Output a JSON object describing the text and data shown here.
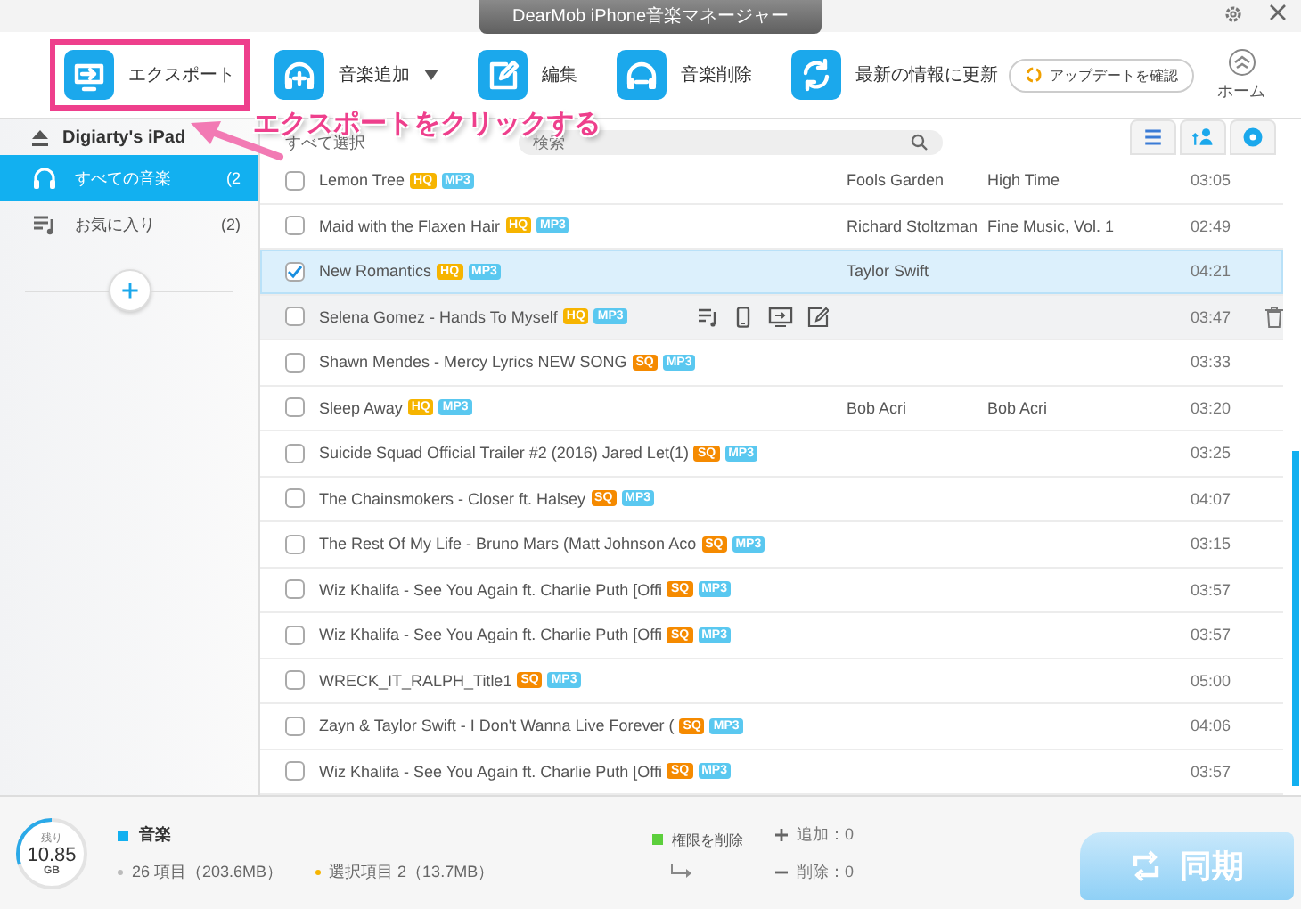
{
  "window": {
    "title": "DearMob iPhone音楽マネージャー"
  },
  "toolbar": [
    {
      "kind": "export",
      "label": "エクスポート",
      "highlighted": true,
      "dropdown": false
    },
    {
      "kind": "add",
      "label": "音楽追加",
      "highlighted": false,
      "dropdown": true
    },
    {
      "kind": "edit",
      "label": "編集",
      "highlighted": false,
      "dropdown": false
    },
    {
      "kind": "delete",
      "label": "音楽削除",
      "highlighted": false,
      "dropdown": false
    },
    {
      "kind": "refresh",
      "label": "最新の情報に更新",
      "highlighted": false,
      "dropdown": false
    }
  ],
  "update_button": "アップデートを確認",
  "home_button": "ホーム",
  "annotation": "エクスポートをクリックする",
  "sidebar": {
    "device": "Digiarty's iPad",
    "items": [
      {
        "kind": "music",
        "label": "すべての音楽",
        "count": "(2",
        "selected": true
      },
      {
        "kind": "playlist",
        "label": "お気に入り",
        "count": "(2)",
        "selected": false
      }
    ]
  },
  "list": {
    "select_all": "すべて選択",
    "search": {
      "placeholder": "検索"
    },
    "view_tabs": [
      {
        "kind": "list"
      },
      {
        "kind": "person"
      },
      {
        "kind": "disc"
      }
    ],
    "rows": [
      {
        "title": "Lemon Tree",
        "quality": {
          "label": "HQ",
          "color": "#f6b400"
        },
        "format": "MP3",
        "artist": "Fools Garden",
        "album": "High Time",
        "time": "03:05",
        "checked": false,
        "selected": false,
        "hovered": false
      },
      {
        "title": "Maid with the Flaxen Hair",
        "quality": {
          "label": "HQ",
          "color": "#f6b400"
        },
        "format": "MP3",
        "artist": "Richard Stoltzman",
        "album": "Fine Music, Vol. 1",
        "time": "02:49",
        "checked": false,
        "selected": false,
        "hovered": false
      },
      {
        "title": "New Romantics",
        "quality": {
          "label": "HQ",
          "color": "#f6b400"
        },
        "format": "MP3",
        "artist": "Taylor Swift",
        "time": "04:21",
        "checked": true,
        "selected": true,
        "hovered": false
      },
      {
        "title": "Selena Gomez - Hands To Myself",
        "quality": {
          "label": "HQ",
          "color": "#f6b400"
        },
        "format": "MP3",
        "time": "03:47",
        "checked": false,
        "selected": false,
        "hovered": true
      },
      {
        "title": "Shawn Mendes - Mercy Lyrics NEW SONG",
        "quality": {
          "label": "SQ",
          "color": "#f58a00"
        },
        "format": "MP3",
        "time": "03:33",
        "checked": false,
        "selected": false,
        "hovered": false
      },
      {
        "title": "Sleep Away",
        "quality": {
          "label": "HQ",
          "color": "#f6b400"
        },
        "format": "MP3",
        "artist": "Bob Acri",
        "album": "Bob Acri",
        "time": "03:20",
        "checked": false,
        "selected": false,
        "hovered": false
      },
      {
        "title": "Suicide Squad Official Trailer #2 (2016) Jared Let(1)",
        "quality": {
          "label": "SQ",
          "color": "#f58a00"
        },
        "format": "MP3",
        "time": "03:25",
        "checked": false,
        "selected": false,
        "hovered": false
      },
      {
        "title": "The Chainsmokers - Closer ft. Halsey",
        "quality": {
          "label": "SQ",
          "color": "#f58a00"
        },
        "format": "MP3",
        "time": "04:07",
        "checked": false,
        "selected": false,
        "hovered": false
      },
      {
        "title": "The Rest Of My Life - Bruno Mars (Matt Johnson Aco",
        "quality": {
          "label": "SQ",
          "color": "#f58a00"
        },
        "format": "MP3",
        "time": "03:15",
        "checked": false,
        "selected": false,
        "hovered": false
      },
      {
        "title": "Wiz Khalifa - See You Again ft. Charlie Puth [Offi",
        "quality": {
          "label": "SQ",
          "color": "#f58a00"
        },
        "format": "MP3",
        "time": "03:57",
        "checked": false,
        "selected": false,
        "hovered": false
      },
      {
        "title": "Wiz Khalifa - See You Again ft. Charlie Puth [Offi",
        "quality": {
          "label": "SQ",
          "color": "#f58a00"
        },
        "format": "MP3",
        "time": "03:57",
        "checked": false,
        "selected": false,
        "hovered": false
      },
      {
        "title": "WRECK_IT_RALPH_Title1",
        "quality": {
          "label": "SQ",
          "color": "#f58a00"
        },
        "format": "MP3",
        "time": "05:00",
        "checked": false,
        "selected": false,
        "hovered": false
      },
      {
        "title": "Zayn & Taylor Swift - I Don't Wanna Live Forever (",
        "quality": {
          "label": "SQ",
          "color": "#f58a00"
        },
        "format": "MP3",
        "time": "04:06",
        "checked": false,
        "selected": false,
        "hovered": false
      },
      {
        "title": "Wiz Khalifa - See You Again ft. Charlie Puth [Offi",
        "quality": {
          "label": "SQ",
          "color": "#f58a00"
        },
        "format": "MP3",
        "time": "03:57",
        "checked": false,
        "selected": false,
        "hovered": false
      }
    ]
  },
  "footer": {
    "storage": {
      "caption": "残り",
      "value": "10.85",
      "unit": "GB",
      "level": 0.3
    },
    "category": "音楽",
    "total": "26 項目（203.6MB）",
    "selection": "選択項目 2（13.7MB）",
    "remove_rights": "権限を削除",
    "added": "追加：0",
    "deleted": "削除：0",
    "sync_button": "同期"
  }
}
